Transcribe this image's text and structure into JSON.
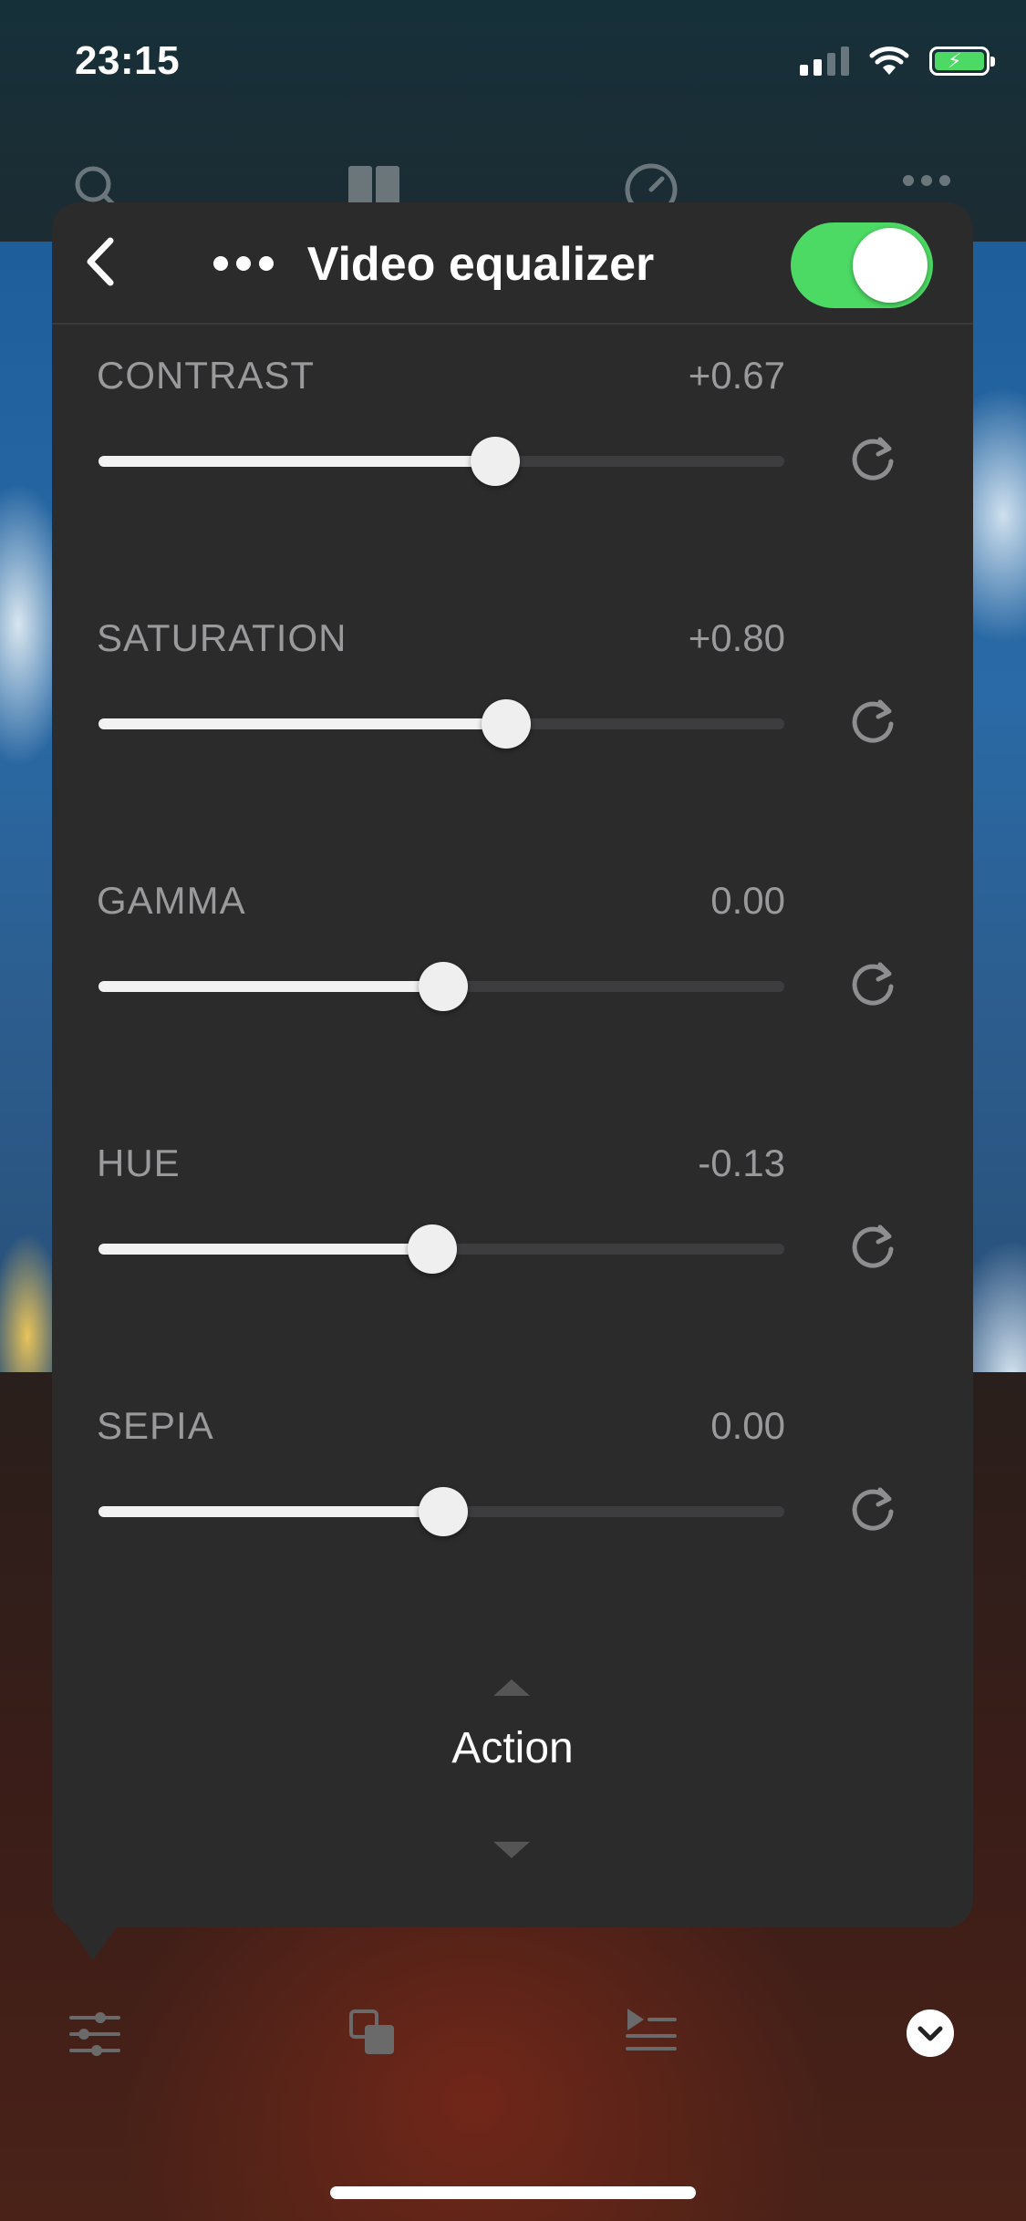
{
  "status_bar": {
    "time": "23:15"
  },
  "header": {
    "title": "Video equalizer",
    "toggle_on": true,
    "toggle_color": "#4cd964"
  },
  "equalizer": [
    {
      "label": "CONTRAST",
      "value": "+0.67",
      "position": 0.578
    },
    {
      "label": "SATURATION",
      "value": "+0.80",
      "position": 0.595
    },
    {
      "label": "GAMMA",
      "value": "0.00",
      "position": 0.502
    },
    {
      "label": "HUE",
      "value": "-0.13",
      "position": 0.487
    },
    {
      "label": "SEPIA",
      "value": "0.00",
      "position": 0.502
    }
  ],
  "picker": {
    "label": "Action"
  },
  "icons": {
    "top_toolbar": [
      "search-icon",
      "book-icon",
      "speedometer-icon",
      "more-icon"
    ],
    "bottom_bar": [
      "sliders-icon",
      "copy-icon",
      "playlist-icon",
      "chevron-down-icon"
    ]
  }
}
